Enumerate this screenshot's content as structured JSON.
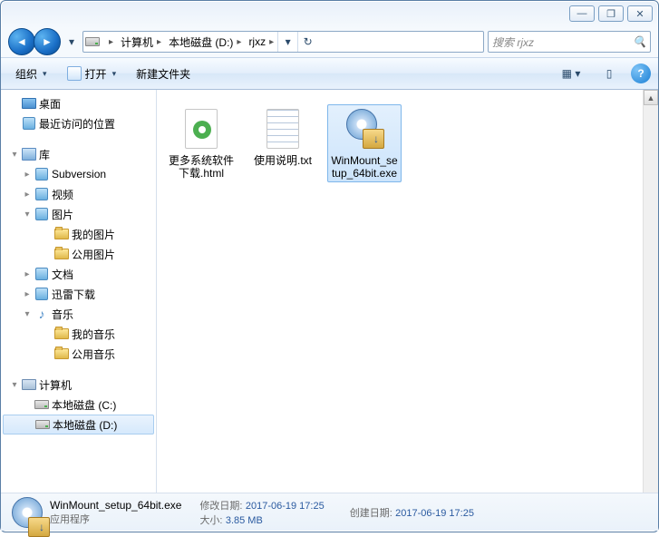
{
  "titlebar": {
    "min": "—",
    "max": "❐",
    "close": "✕"
  },
  "nav": {
    "back": "◄",
    "fwd": "►",
    "drop": "▾",
    "refresh": "↻"
  },
  "breadcrumbs": [
    {
      "label": "计算机"
    },
    {
      "label": "本地磁盘 (D:)"
    },
    {
      "label": "rjxz"
    }
  ],
  "search": {
    "placeholder": "搜索 rjxz"
  },
  "toolbar": {
    "organize": "组织",
    "open": "打开",
    "newfolder": "新建文件夹"
  },
  "tree": {
    "desktop": "桌面",
    "recent": "最近访问的位置",
    "libraries": "库",
    "subversion": "Subversion",
    "videos": "视频",
    "pictures": "图片",
    "mypics": "我的图片",
    "pubpics": "公用图片",
    "documents": "文档",
    "xunlei": "迅雷下载",
    "music": "音乐",
    "mymusic": "我的音乐",
    "pubmusic": "公用音乐",
    "computer": "计算机",
    "drivec": "本地磁盘 (C:)",
    "drived": "本地磁盘 (D:)"
  },
  "items": [
    {
      "name": "更多系统软件下载.html",
      "type": "html"
    },
    {
      "name": "使用说明.txt",
      "type": "txt"
    },
    {
      "name": "WinMount_setup_64bit.exe",
      "type": "exe",
      "selected": true
    }
  ],
  "details": {
    "name": "WinMount_setup_64bit.exe",
    "type": "应用程序",
    "mod_label": "修改日期:",
    "mod_value": "2017-06-19 17:25",
    "size_label": "大小:",
    "size_value": "3.85 MB",
    "created_label": "创建日期:",
    "created_value": "2017-06-19 17:25"
  }
}
